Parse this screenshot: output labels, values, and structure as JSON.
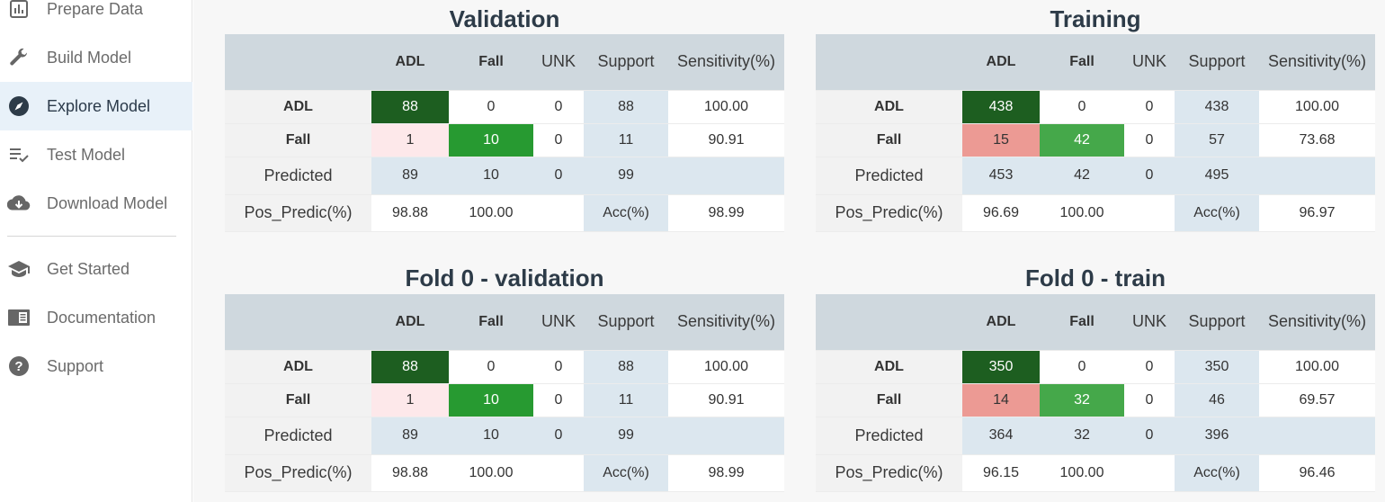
{
  "sidebar": {
    "items": [
      {
        "label": "Prepare Data",
        "icon": "bar-chart-icon"
      },
      {
        "label": "Build Model",
        "icon": "wrench-icon"
      },
      {
        "label": "Explore Model",
        "icon": "compass-icon",
        "active": true
      },
      {
        "label": "Test Model",
        "icon": "checklist-icon"
      },
      {
        "label": "Download Model",
        "icon": "cloud-download-icon"
      },
      {
        "label": "Get Started",
        "icon": "graduation-cap-icon"
      },
      {
        "label": "Documentation",
        "icon": "book-icon"
      },
      {
        "label": "Support",
        "icon": "help-circle-icon"
      }
    ]
  },
  "headers": {
    "adl": "ADL",
    "fall": "Fall",
    "unk": "UNK",
    "support": "Support",
    "sensitivity": "Sensitivity(%)"
  },
  "row_labels": {
    "adl": "ADL",
    "fall": "Fall",
    "predicted": "Predicted",
    "pos_predic": "Pos_Predic(%)",
    "acc": "Acc(%)"
  },
  "colors": {
    "dark_green": "#1d5e20",
    "green": "#279a31",
    "light_green": "#45a84a",
    "pink": "#fde8ea",
    "salmon": "#ec9a94",
    "header_gray": "#cfd8de",
    "support_blue": "#dce7ef"
  },
  "panels": {
    "validation": {
      "title": "Validation",
      "adl": {
        "adl": "88",
        "fall": "0",
        "unk": "0",
        "support": "88",
        "sensitivity": "100.00"
      },
      "fall": {
        "adl": "1",
        "fall": "10",
        "unk": "0",
        "support": "11",
        "sensitivity": "90.91"
      },
      "predicted": {
        "adl": "89",
        "fall": "10",
        "unk": "0",
        "support": "99"
      },
      "pos_predic": {
        "adl": "98.88",
        "fall": "100.00",
        "acc": "98.99"
      }
    },
    "training": {
      "title": "Training",
      "adl": {
        "adl": "438",
        "fall": "0",
        "unk": "0",
        "support": "438",
        "sensitivity": "100.00"
      },
      "fall": {
        "adl": "15",
        "fall": "42",
        "unk": "0",
        "support": "57",
        "sensitivity": "73.68"
      },
      "predicted": {
        "adl": "453",
        "fall": "42",
        "unk": "0",
        "support": "495"
      },
      "pos_predic": {
        "adl": "96.69",
        "fall": "100.00",
        "acc": "96.97"
      }
    },
    "fold0_validation": {
      "title": "Fold 0 - validation",
      "adl": {
        "adl": "88",
        "fall": "0",
        "unk": "0",
        "support": "88",
        "sensitivity": "100.00"
      },
      "fall": {
        "adl": "1",
        "fall": "10",
        "unk": "0",
        "support": "11",
        "sensitivity": "90.91"
      },
      "predicted": {
        "adl": "89",
        "fall": "10",
        "unk": "0",
        "support": "99"
      },
      "pos_predic": {
        "adl": "98.88",
        "fall": "100.00",
        "acc": "98.99"
      }
    },
    "fold0_train": {
      "title": "Fold 0 - train",
      "adl": {
        "adl": "350",
        "fall": "0",
        "unk": "0",
        "support": "350",
        "sensitivity": "100.00"
      },
      "fall": {
        "adl": "14",
        "fall": "32",
        "unk": "0",
        "support": "46",
        "sensitivity": "69.57"
      },
      "predicted": {
        "adl": "364",
        "fall": "32",
        "unk": "0",
        "support": "396"
      },
      "pos_predic": {
        "adl": "96.15",
        "fall": "100.00",
        "acc": "96.46"
      }
    }
  }
}
